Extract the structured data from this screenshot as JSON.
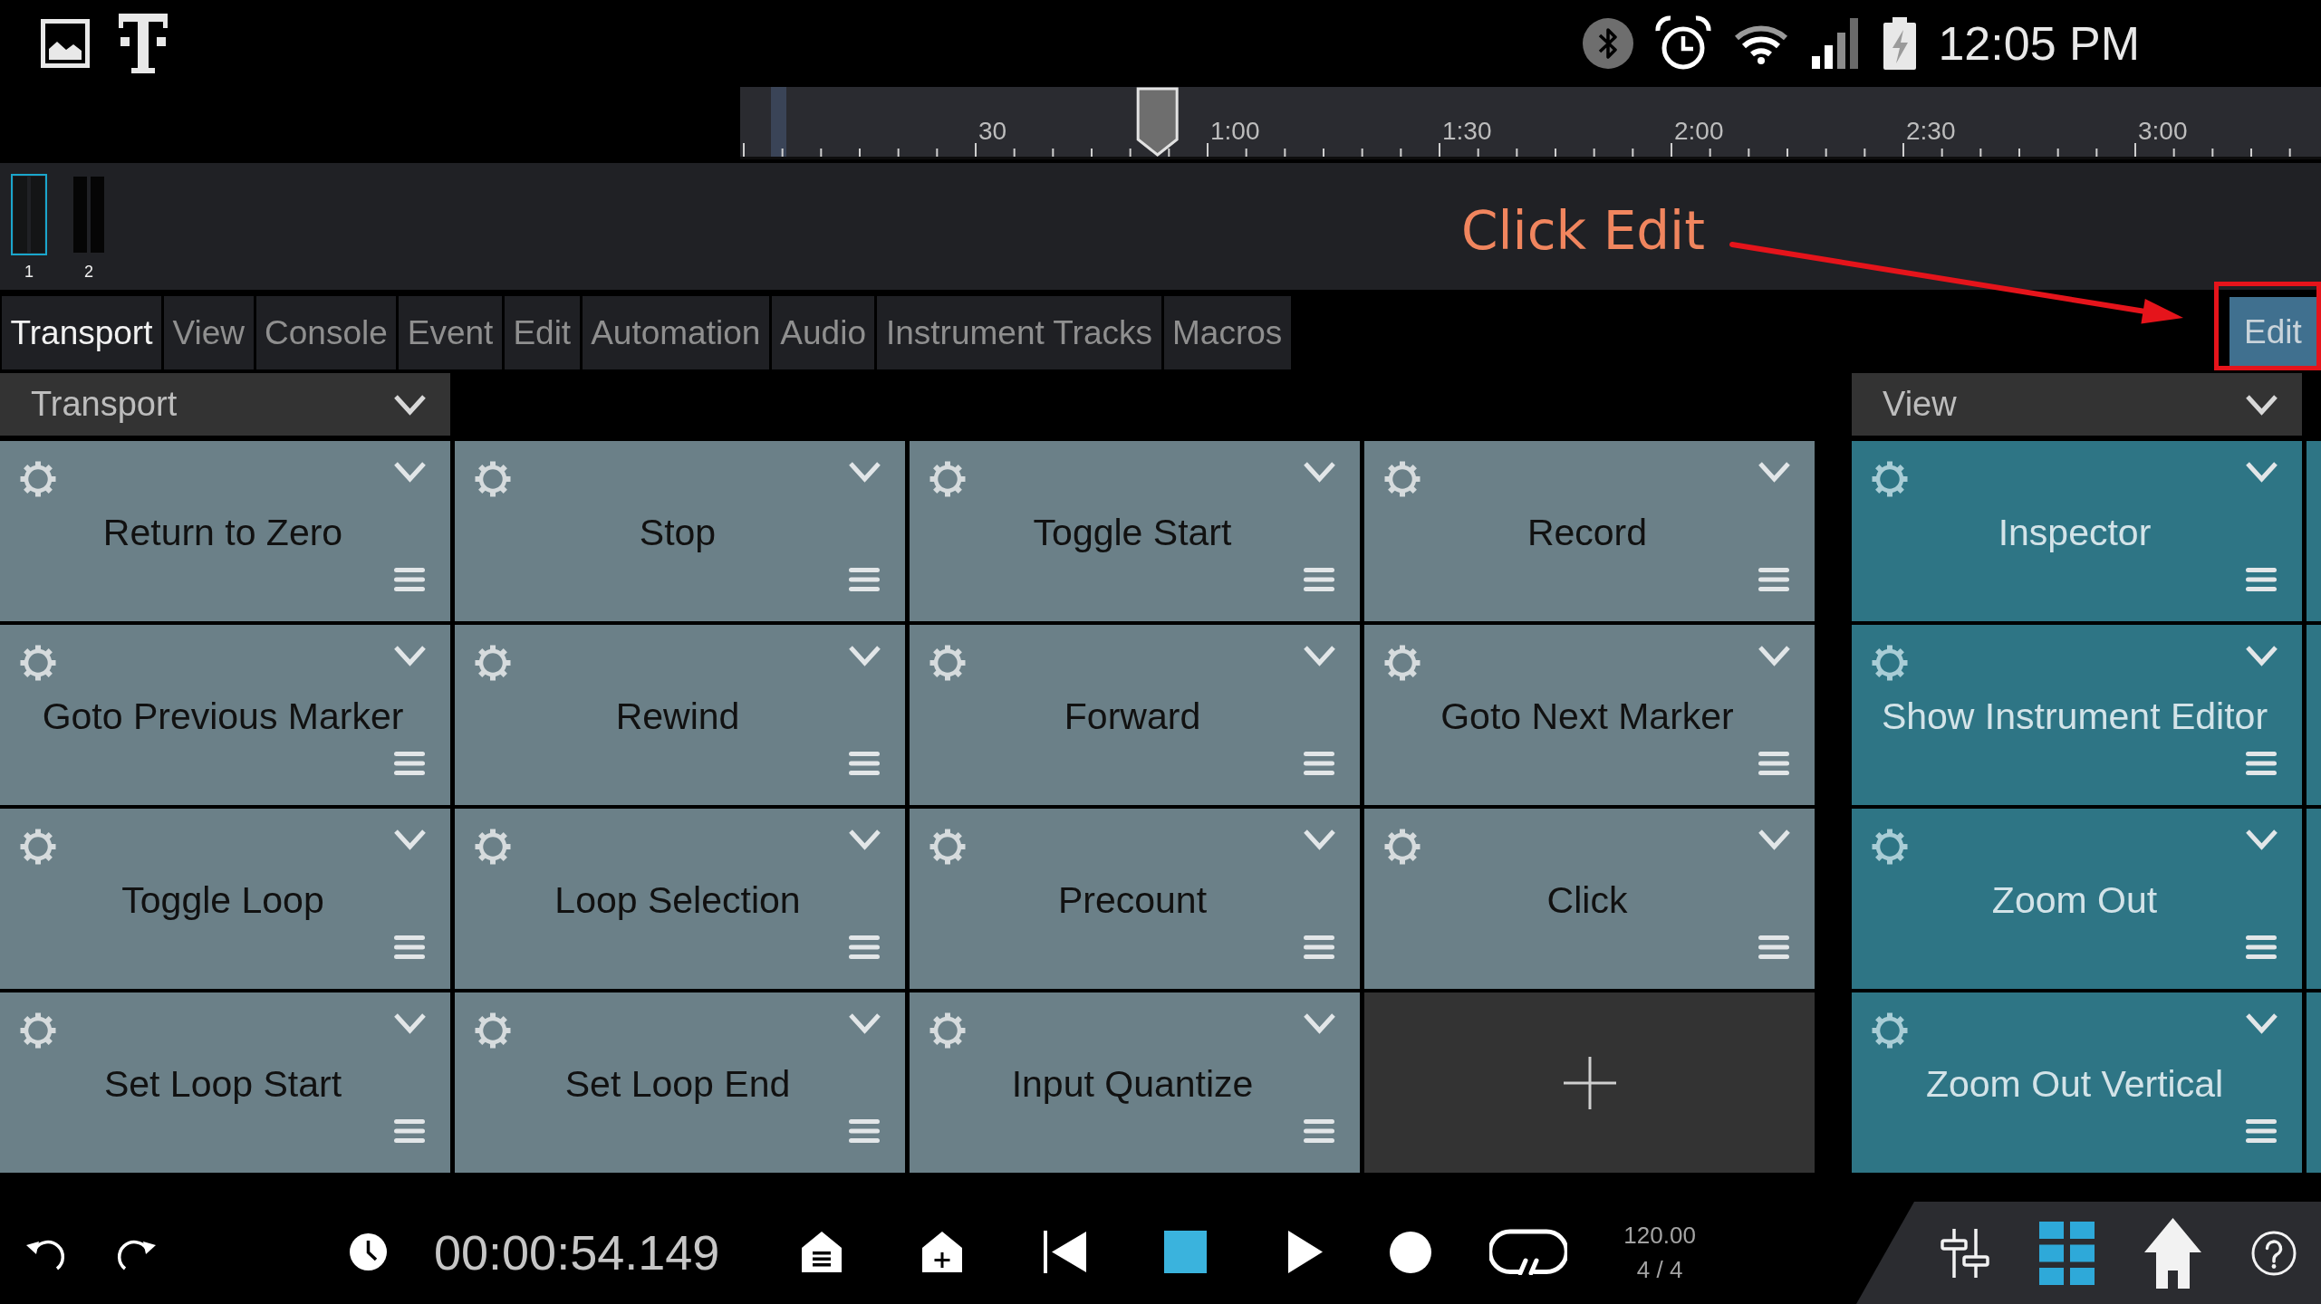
{
  "status_bar": {
    "time": "12:05 PM"
  },
  "ruler": {
    "labels": [
      "30",
      "1:00",
      "1:30",
      "2:00",
      "2:30",
      "3:00"
    ],
    "playhead": {
      "level": 0.264
    }
  },
  "tracks": [
    {
      "label": "1",
      "selected": true
    },
    {
      "label": "2",
      "selected": false
    }
  ],
  "annotation": {
    "text": "Click Edit"
  },
  "tabs": [
    {
      "label": "Transport",
      "selected": true
    },
    {
      "label": "View",
      "selected": false
    },
    {
      "label": "Console",
      "selected": false
    },
    {
      "label": "Event",
      "selected": false
    },
    {
      "label": "Edit",
      "selected": false
    },
    {
      "label": "Automation",
      "selected": false
    },
    {
      "label": "Audio",
      "selected": false
    },
    {
      "label": "Instrument Tracks",
      "selected": false
    },
    {
      "label": "Macros",
      "selected": false
    }
  ],
  "edit_button": {
    "label": "Edit"
  },
  "panels": [
    {
      "title": "Transport",
      "color": "#6b8088",
      "cards": [
        {
          "kind": "action",
          "label": "Return to Zero"
        },
        {
          "kind": "action",
          "label": "Stop"
        },
        {
          "kind": "action",
          "label": "Toggle Start"
        },
        {
          "kind": "action",
          "label": "Record"
        },
        {
          "kind": "action",
          "label": "Goto Previous Marker"
        },
        {
          "kind": "action",
          "label": "Rewind"
        },
        {
          "kind": "action",
          "label": "Forward"
        },
        {
          "kind": "action",
          "label": "Goto Next Marker"
        },
        {
          "kind": "action",
          "label": "Toggle Loop"
        },
        {
          "kind": "action",
          "label": "Loop Selection"
        },
        {
          "kind": "action",
          "label": "Precount"
        },
        {
          "kind": "action",
          "label": "Click"
        },
        {
          "kind": "action",
          "label": "Set Loop Start"
        },
        {
          "kind": "action",
          "label": "Set Loop End"
        },
        {
          "kind": "action",
          "label": "Input Quantize"
        },
        {
          "kind": "add"
        }
      ]
    },
    {
      "title": "View",
      "color": "#2e7585",
      "cards": [
        {
          "kind": "action",
          "label": "Inspector"
        },
        {
          "kind": "action",
          "label": "Show Instrument Editor"
        },
        {
          "kind": "action",
          "label": "Zoom Out"
        },
        {
          "kind": "action",
          "label": "Zoom Out Vertical"
        }
      ]
    }
  ],
  "transport_bar": {
    "time": "00:00:54.149",
    "controls": [
      {
        "kind": "marker_list",
        "active": false
      },
      {
        "kind": "marker_add",
        "active": false
      },
      {
        "kind": "skip_back",
        "active": false
      },
      {
        "kind": "stop",
        "active": true
      },
      {
        "kind": "play",
        "active": false
      },
      {
        "kind": "record",
        "active": false
      },
      {
        "kind": "loop",
        "active": false
      }
    ],
    "tempo": "120.00",
    "time_signature": "4 / 4"
  },
  "nav": [
    {
      "kind": "sliders",
      "selected": false
    },
    {
      "kind": "grid",
      "selected": true
    },
    {
      "kind": "home",
      "selected": false
    },
    {
      "kind": "help",
      "selected": false
    }
  ]
}
